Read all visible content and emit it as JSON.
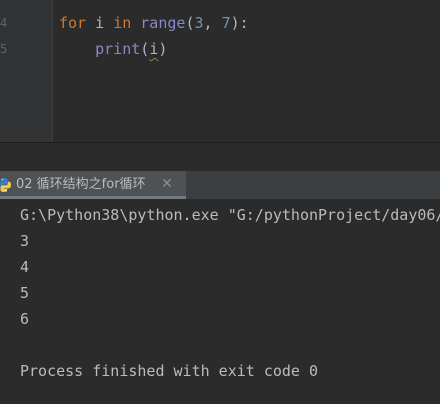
{
  "editor": {
    "line_numbers": [
      "4",
      "5"
    ],
    "code": {
      "line1": {
        "kw_for": "for",
        "var_i": " i ",
        "kw_in": "in",
        "space": " ",
        "range_fn": "range",
        "paren_open": "(",
        "num_start": "3",
        "comma": ", ",
        "num_end": "7",
        "paren_close_colon": "):"
      },
      "line2": {
        "indent": "    ",
        "print_fn": "print",
        "paren_open": "(",
        "arg": "i",
        "paren_close": ")"
      }
    }
  },
  "run_tab": {
    "label": "02 循环结构之for循环",
    "close_glyph": "✕",
    "icon": "python-icon"
  },
  "console": {
    "lines": [
      "G:\\Python38\\python.exe \"G:/pythonProject/day06/",
      "3",
      "4",
      "5",
      "6",
      "",
      "Process finished with exit code 0"
    ]
  },
  "colors": {
    "background": "#2b2b2b",
    "keyword": "#cc7832",
    "number": "#6897bb",
    "builtin": "#8888c6",
    "text": "#a9b7c6",
    "console_text": "#bbbbbb"
  }
}
